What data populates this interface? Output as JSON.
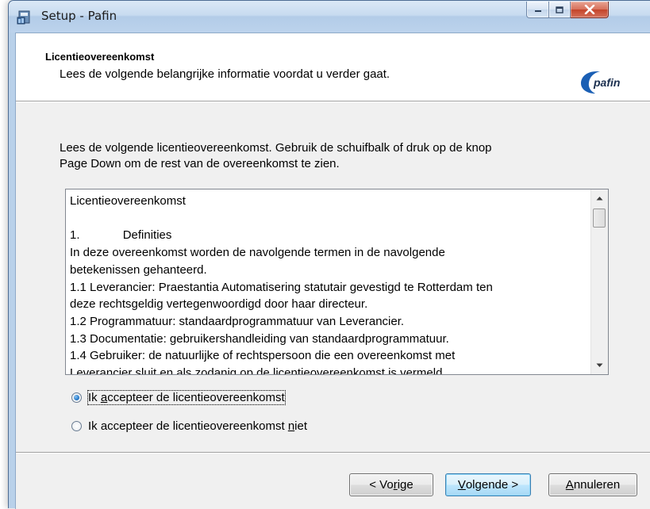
{
  "window": {
    "title": "Setup - Pafin"
  },
  "header": {
    "title": "Licentieovereenkomst",
    "subtitle": "Lees de volgende belangrijke informatie voordat u verder gaat.",
    "logo_text": "pafin"
  },
  "intro": {
    "line1": "Lees de volgende licentieovereenkomst. Gebruik de schuifbalk of druk op de knop",
    "line2": "Page Down om de rest van de overeenkomst te zien."
  },
  "license": {
    "text": "Licentieovereenkomst\n\n1.\t\tDefinities\nIn deze overeenkomst worden de navolgende termen in de navolgende\nbetekenissen gehanteerd.\n1.1 Leverancier: Praestantia Automatisering statutair gevestigd te Rotterdam ten\ndeze rechtsgeldig vertegenwoordigd door haar directeur.\n1.2 Programmatuur: standaardprogrammatuur van Leverancier.\n1.3 Documentatie: gebruikershandleiding van standaardprogrammatuur.\n1.4 Gebruiker: de natuurlijke of rechtspersoon die een overeenkomst met\nLeverancier sluit en als zodanig op de licentieovereenkomst is vermeld."
  },
  "options": {
    "accept": {
      "pre": "Ik ",
      "key": "a",
      "post": "ccepteer de licentieovereenkomst",
      "checked": true
    },
    "decline": {
      "pre": "Ik accepteer de licentieovereenkomst ",
      "key": "n",
      "post": "iet",
      "checked": false
    }
  },
  "buttons": {
    "back": {
      "pre": "< Vo",
      "key": "r",
      "post": "ige"
    },
    "next": {
      "pre": "",
      "key": "V",
      "post": "olgende >"
    },
    "cancel": {
      "pre": "",
      "key": "A",
      "post": "nnuleren"
    }
  },
  "icons": {
    "app": "setup-installer-icon",
    "minimize": "minimize-icon",
    "maximize": "maximize-icon",
    "close": "close-icon",
    "scroll_up": "scroll-up-arrow-icon",
    "scroll_down": "scroll-down-arrow-icon"
  },
  "colors": {
    "accent": "#3c7fb1",
    "close_red": "#c3442a",
    "logo_blue": "#1a5fb4"
  }
}
